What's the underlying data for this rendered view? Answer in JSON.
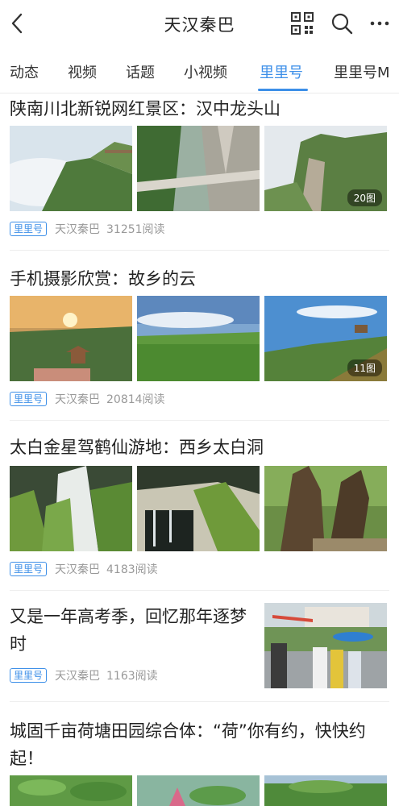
{
  "header": {
    "title": "天汉秦巴",
    "back_icon": "back-chevron-icon",
    "qr_icon": "qr-code-icon",
    "search_icon": "search-icon",
    "more_icon": "more-dots-icon"
  },
  "tabs": [
    {
      "label": "动态",
      "active": false
    },
    {
      "label": "视频",
      "active": false
    },
    {
      "label": "话题",
      "active": false
    },
    {
      "label": "小视频",
      "active": false
    },
    {
      "label": "里里号",
      "active": true
    },
    {
      "label": "里里号M",
      "active": false
    }
  ],
  "accent_color": "#3d8fe8",
  "articles": [
    {
      "title": "陕南川北新锐网红景区：汉中龙头山",
      "badge": "里里号",
      "author": "天汉秦巴",
      "reads": "31251阅读",
      "image_count": "20图"
    },
    {
      "title": "手机摄影欣赏：故乡的云",
      "badge": "里里号",
      "author": "天汉秦巴",
      "reads": "20814阅读",
      "image_count": "11图"
    },
    {
      "title": "太白金星驾鹤仙游地：西乡太白洞",
      "badge": "里里号",
      "author": "天汉秦巴",
      "reads": "4183阅读"
    },
    {
      "title": "又是一年高考季，回忆那年逐梦时",
      "badge": "里里号",
      "author": "天汉秦巴",
      "reads": "1163阅读"
    },
    {
      "title": "城固千亩荷塘田园综合体：“荷”你有约，快快约起！"
    }
  ]
}
